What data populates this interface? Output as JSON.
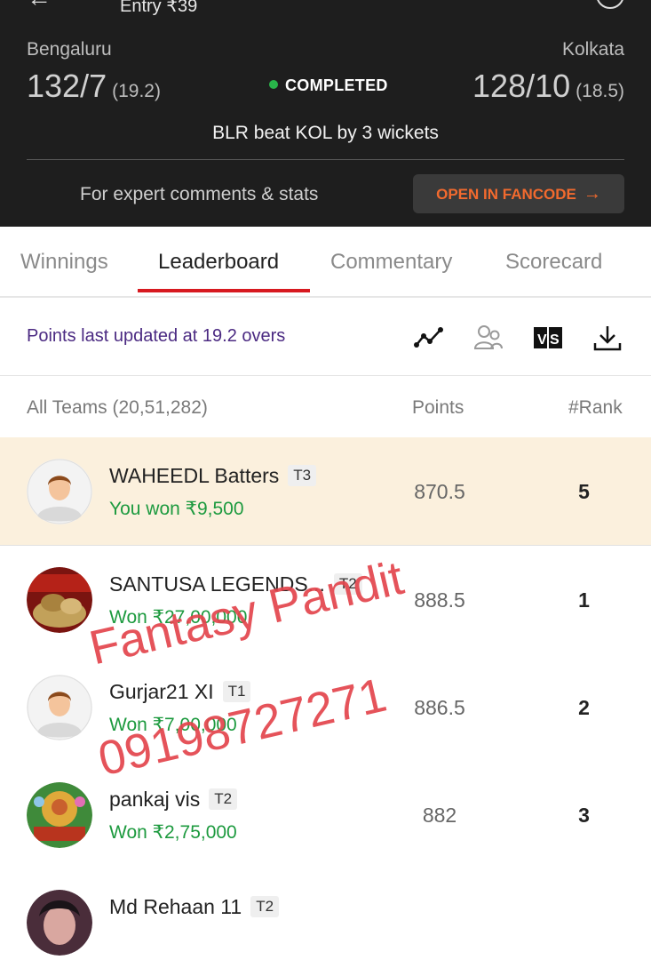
{
  "header": {
    "entry": "Entry ₹39",
    "team1": {
      "name": "Bengaluru",
      "score": "132/7",
      "overs": "(19.2)"
    },
    "team2": {
      "name": "Kolkata",
      "score": "128/10",
      "overs": "(18.5)"
    },
    "status": "COMPLETED",
    "result": "BLR beat KOL by 3 wickets",
    "expert_text": "For expert comments & stats",
    "fancode_button": "OPEN IN FANCODE",
    "colors": {
      "status_dot": "#29b64a",
      "fancode_orange": "#f26a2e"
    }
  },
  "tabs": [
    {
      "label": "Winnings",
      "active": false
    },
    {
      "label": "Leaderboard",
      "active": true
    },
    {
      "label": "Commentary",
      "active": false
    },
    {
      "label": "Scorecard",
      "active": false
    }
  ],
  "toolbar": {
    "updated_text": "Points last updated at 19.2 overs",
    "icons": [
      "trend-chart-icon",
      "compare-users-icon",
      "versus-icon",
      "download-icon"
    ]
  },
  "table": {
    "teams_header": "All Teams (20,51,282)",
    "points_header": "Points",
    "rank_header": "#Rank",
    "rows": [
      {
        "name": "WAHEEDL Batters",
        "tag": "T3",
        "won": "You won ₹9,500",
        "points": "870.5",
        "rank": "5",
        "highlight": true
      },
      {
        "name": "SANTUSA LEGENDS...",
        "tag": "T2",
        "won": "Won ₹27,00,000",
        "points": "888.5",
        "rank": "1"
      },
      {
        "name": "Gurjar21 XI",
        "tag": "T1",
        "won": "Won ₹7,00,000",
        "points": "886.5",
        "rank": "2"
      },
      {
        "name": "pankaj vis",
        "tag": "T2",
        "won": "Won ₹2,75,000",
        "points": "882",
        "rank": "3"
      },
      {
        "name": "Md Rehaan 11",
        "tag": "T2",
        "won": "",
        "points": "",
        "rank": ""
      }
    ]
  },
  "watermark": {
    "line1": "Fantasy Pandit",
    "line2": "09198727271"
  }
}
